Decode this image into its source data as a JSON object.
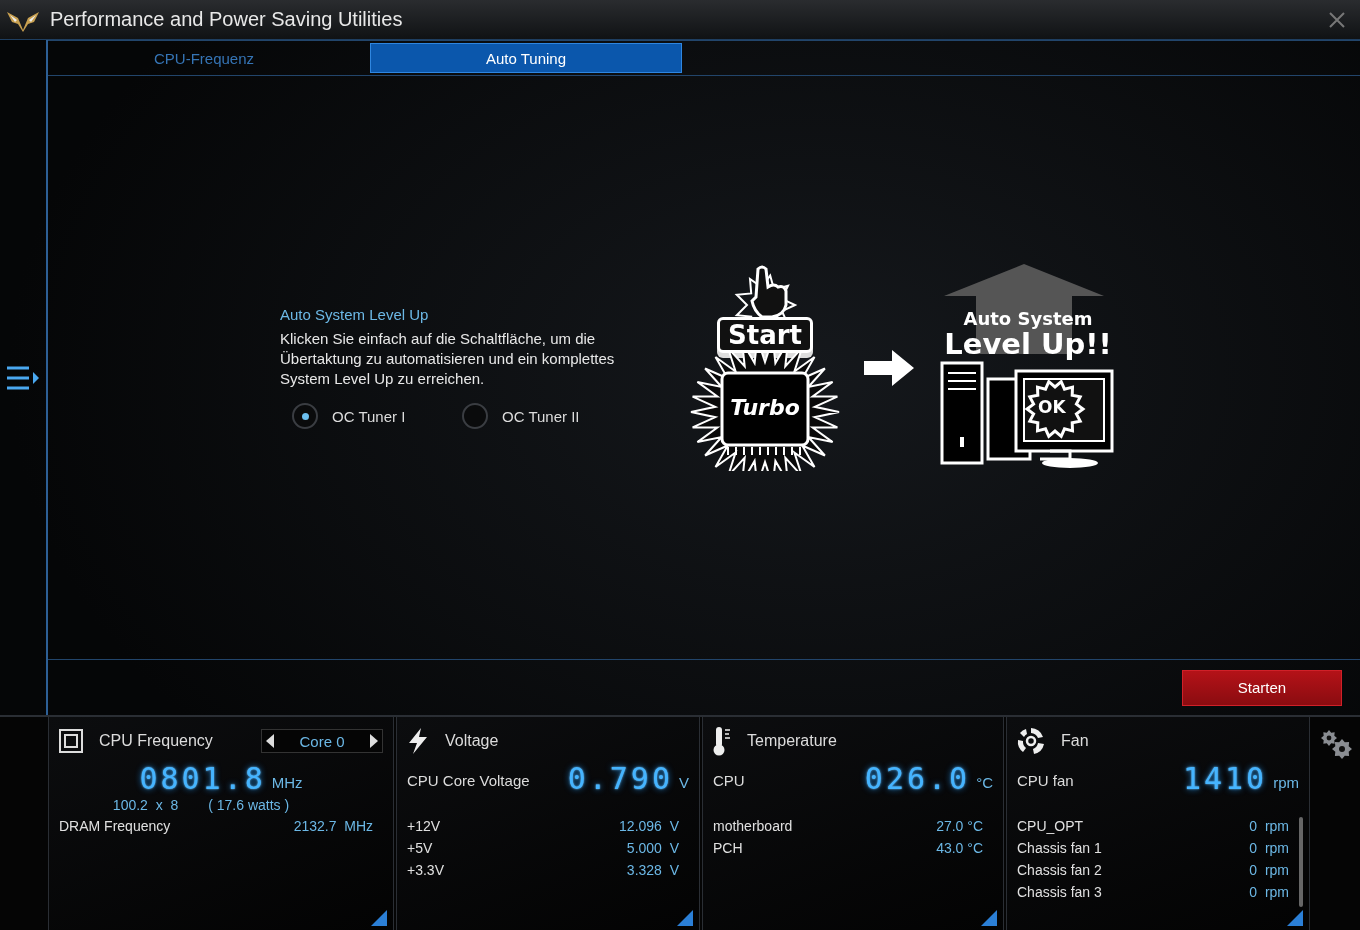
{
  "window": {
    "title": "Performance and Power Saving Utilities"
  },
  "tabs": [
    {
      "label": "CPU-Frequenz",
      "selected": false
    },
    {
      "label": "Auto Tuning",
      "selected": true
    }
  ],
  "auto_tuning": {
    "heading": "Auto System Level Up",
    "description": "Klicken Sie einfach auf die Schaltfläche, um die Übertaktung zu automatisieren und ein komplettes System Level Up zu erreichen.",
    "options": [
      {
        "label": "OC Tuner I",
        "selected": true
      },
      {
        "label": "OC Tuner II",
        "selected": false
      }
    ],
    "illustration": {
      "start_key": "Start",
      "chip_label": "Turbo",
      "banner_line_1": "Auto System",
      "banner_line_2": "Level Up!!",
      "screen_label": "OK"
    },
    "start_button": "Starten"
  },
  "monitors": [
    {
      "kind": "cpu_frequency",
      "title": "CPU Frequency",
      "selector": "Core 0",
      "reading": "0801.8",
      "unit": "MHz",
      "multiplier": "100.2  x  8",
      "power": "( 17.6 watts )",
      "rows": [
        {
          "label": "DRAM Frequency",
          "value": "2132.7  MHz"
        }
      ]
    },
    {
      "kind": "voltage",
      "title": "Voltage",
      "main_label": "CPU Core Voltage",
      "reading": "0.790",
      "unit": "V",
      "rows": [
        {
          "label": "+12V",
          "value": "12.096  V"
        },
        {
          "label": "+5V",
          "value": "5.000  V"
        },
        {
          "label": "+3.3V",
          "value": "3.328  V"
        }
      ]
    },
    {
      "kind": "temperature",
      "title": "Temperature",
      "main_label": "CPU",
      "reading": "026.0",
      "unit": "°C",
      "rows": [
        {
          "label": "motherboard",
          "value": "27.0 °C"
        },
        {
          "label": "PCH",
          "value": "43.0 °C"
        }
      ]
    },
    {
      "kind": "fan",
      "title": "Fan",
      "main_label": "CPU fan",
      "reading": "1410",
      "unit": "rpm",
      "rows": [
        {
          "label": "CPU_OPT",
          "value": "0  rpm"
        },
        {
          "label": "Chassis fan 1",
          "value": "0  rpm"
        },
        {
          "label": "Chassis fan 2",
          "value": "0  rpm"
        },
        {
          "label": "Chassis fan 3",
          "value": "0  rpm"
        }
      ]
    }
  ]
}
